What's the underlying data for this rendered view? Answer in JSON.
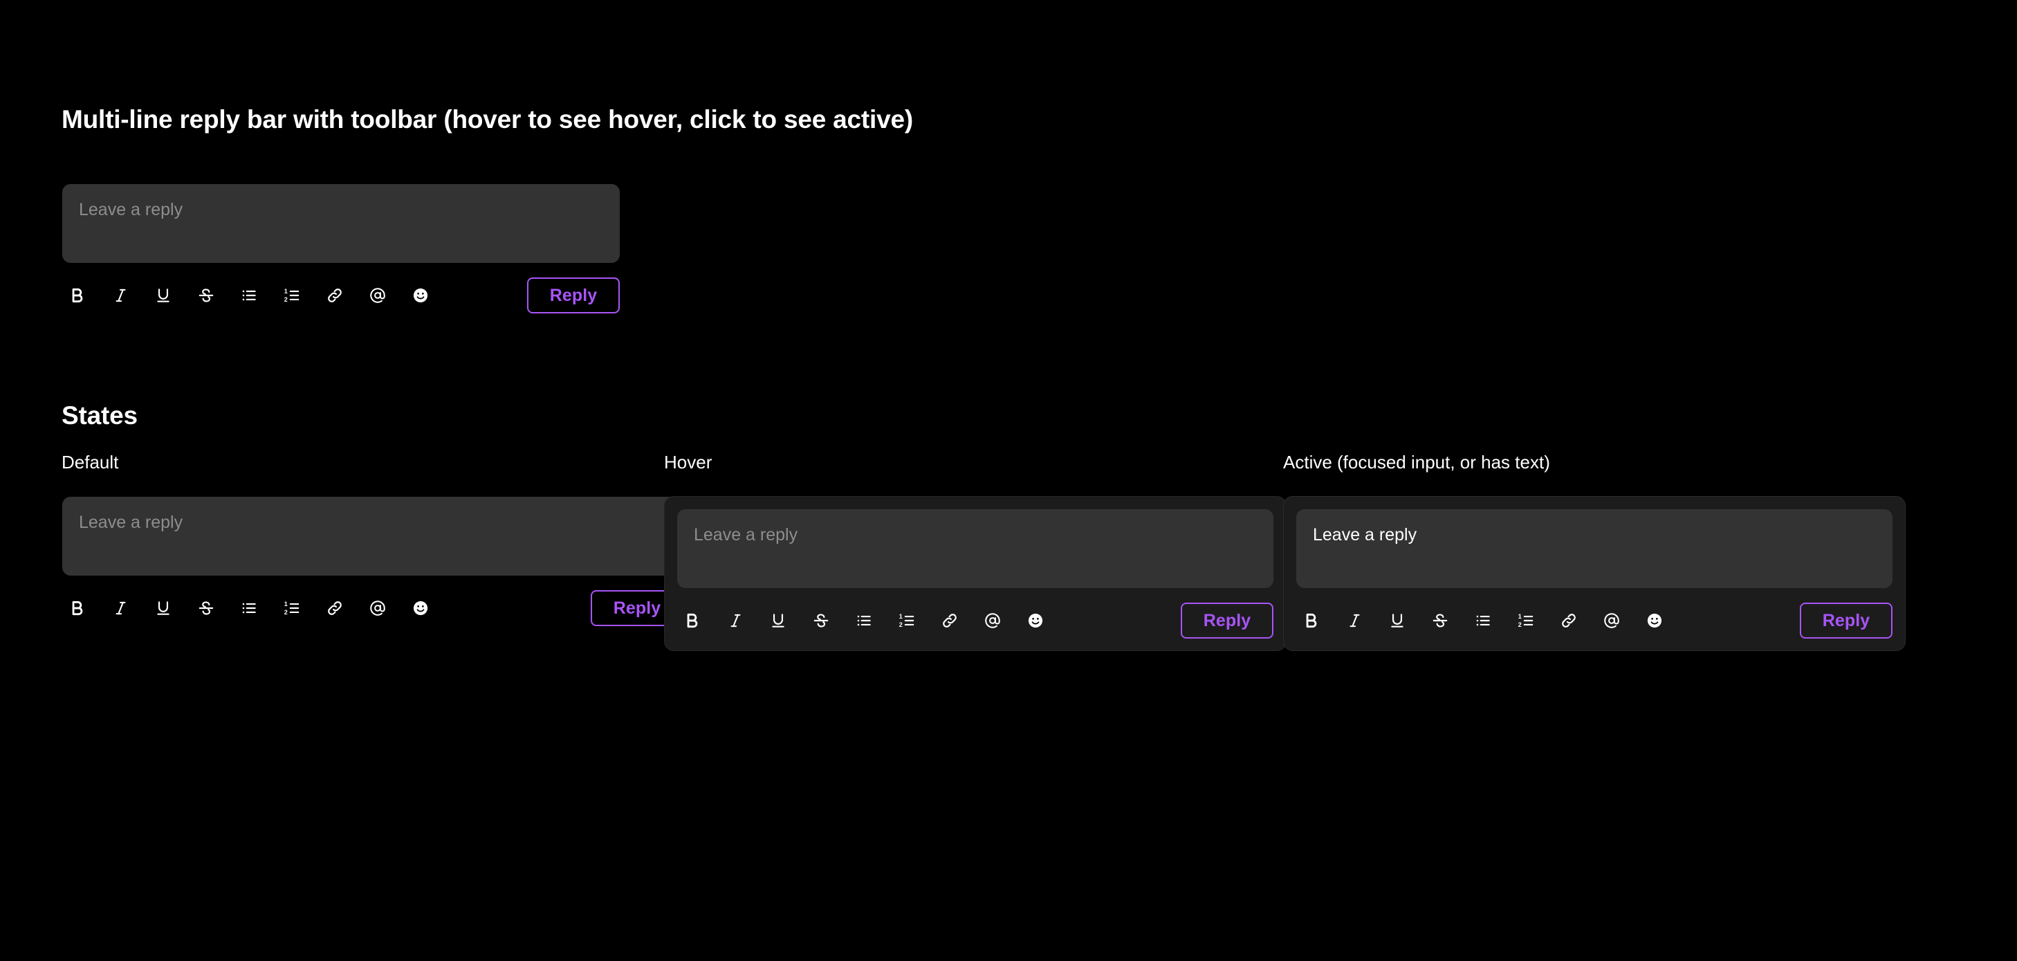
{
  "demo": {
    "title": "Multi-line reply bar with toolbar (hover to see hover, click to see active)",
    "reply_bar": {
      "placeholder": "Leave a reply",
      "value": "",
      "submit_label": "Reply"
    }
  },
  "states": {
    "heading": "States",
    "items": [
      {
        "label": "Default",
        "placeholder": "Leave a reply",
        "value": "",
        "submit_label": "Reply",
        "container_style": "transparent"
      },
      {
        "label": "Hover",
        "placeholder": "Leave a reply",
        "value": "",
        "submit_label": "Reply",
        "container_style": "raised"
      },
      {
        "label": "Active (focused input, or has text)",
        "placeholder": "Leave a reply",
        "value": "Leave a reply",
        "submit_label": "Reply",
        "container_style": "raised-focused"
      }
    ]
  },
  "toolbar": {
    "buttons": [
      {
        "name": "bold-icon",
        "title": "Bold"
      },
      {
        "name": "italic-icon",
        "title": "Italic"
      },
      {
        "name": "underline-icon",
        "title": "Underline"
      },
      {
        "name": "strikethrough-icon",
        "title": "Strikethrough"
      },
      {
        "name": "bullet-list-icon",
        "title": "Bulleted list"
      },
      {
        "name": "numbered-list-icon",
        "title": "Numbered list"
      },
      {
        "name": "link-icon",
        "title": "Link"
      },
      {
        "name": "mention-icon",
        "title": "Mention"
      },
      {
        "name": "emoji-icon",
        "title": "Emoji"
      }
    ]
  },
  "colors": {
    "page_background": "#000000",
    "input_background": "#333333",
    "card_background": "#1c1c1c",
    "accent": "#a855f7",
    "text_primary": "#ffffff",
    "text_placeholder": "#8d8d8d"
  }
}
